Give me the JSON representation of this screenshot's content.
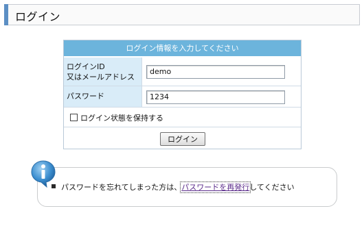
{
  "header": {
    "title": "ログイン"
  },
  "form": {
    "heading": "ログイン情報を入力してください",
    "id_label_line1": "ログインID",
    "id_label_line2": "又はメールアドレス",
    "id_value": "demo",
    "password_label": "パスワード",
    "password_value": "1234",
    "remember_label": "ログイン状態を保持する",
    "login_button": "ログイン"
  },
  "info": {
    "text_before": "パスワードを忘れてしまった方は、",
    "link_text": "パスワードを再発行",
    "text_after": "してください"
  },
  "colors": {
    "header_accent": "#5c8fc4",
    "form_head": "#6cb4dc",
    "label_bg": "#d9ecf8",
    "info_icon": "#3d8fd0"
  },
  "icons": {
    "info": "info-icon"
  }
}
